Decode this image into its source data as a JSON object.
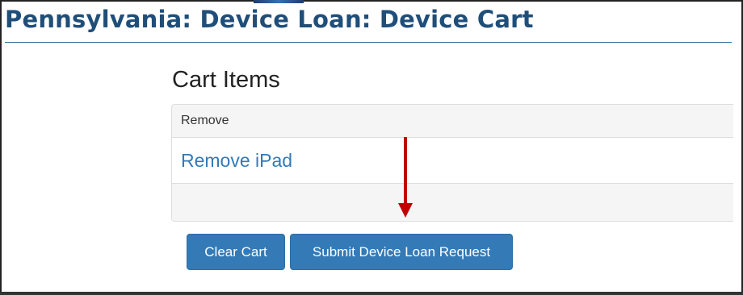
{
  "page": {
    "title": "Pennsylvania: Device Loan: Device Cart"
  },
  "cart": {
    "heading": "Cart Items",
    "column_header": "Remove",
    "items": [
      {
        "remove_label": "Remove iPad"
      }
    ]
  },
  "actions": {
    "clear_label": "Clear Cart",
    "submit_label": "Submit Device Loan Request"
  },
  "colors": {
    "title": "#1f4e79",
    "link": "#337ab7",
    "button": "#337ab7",
    "annotation_arrow": "#c00000"
  },
  "icons": {
    "annotation": "down-arrow-icon"
  }
}
